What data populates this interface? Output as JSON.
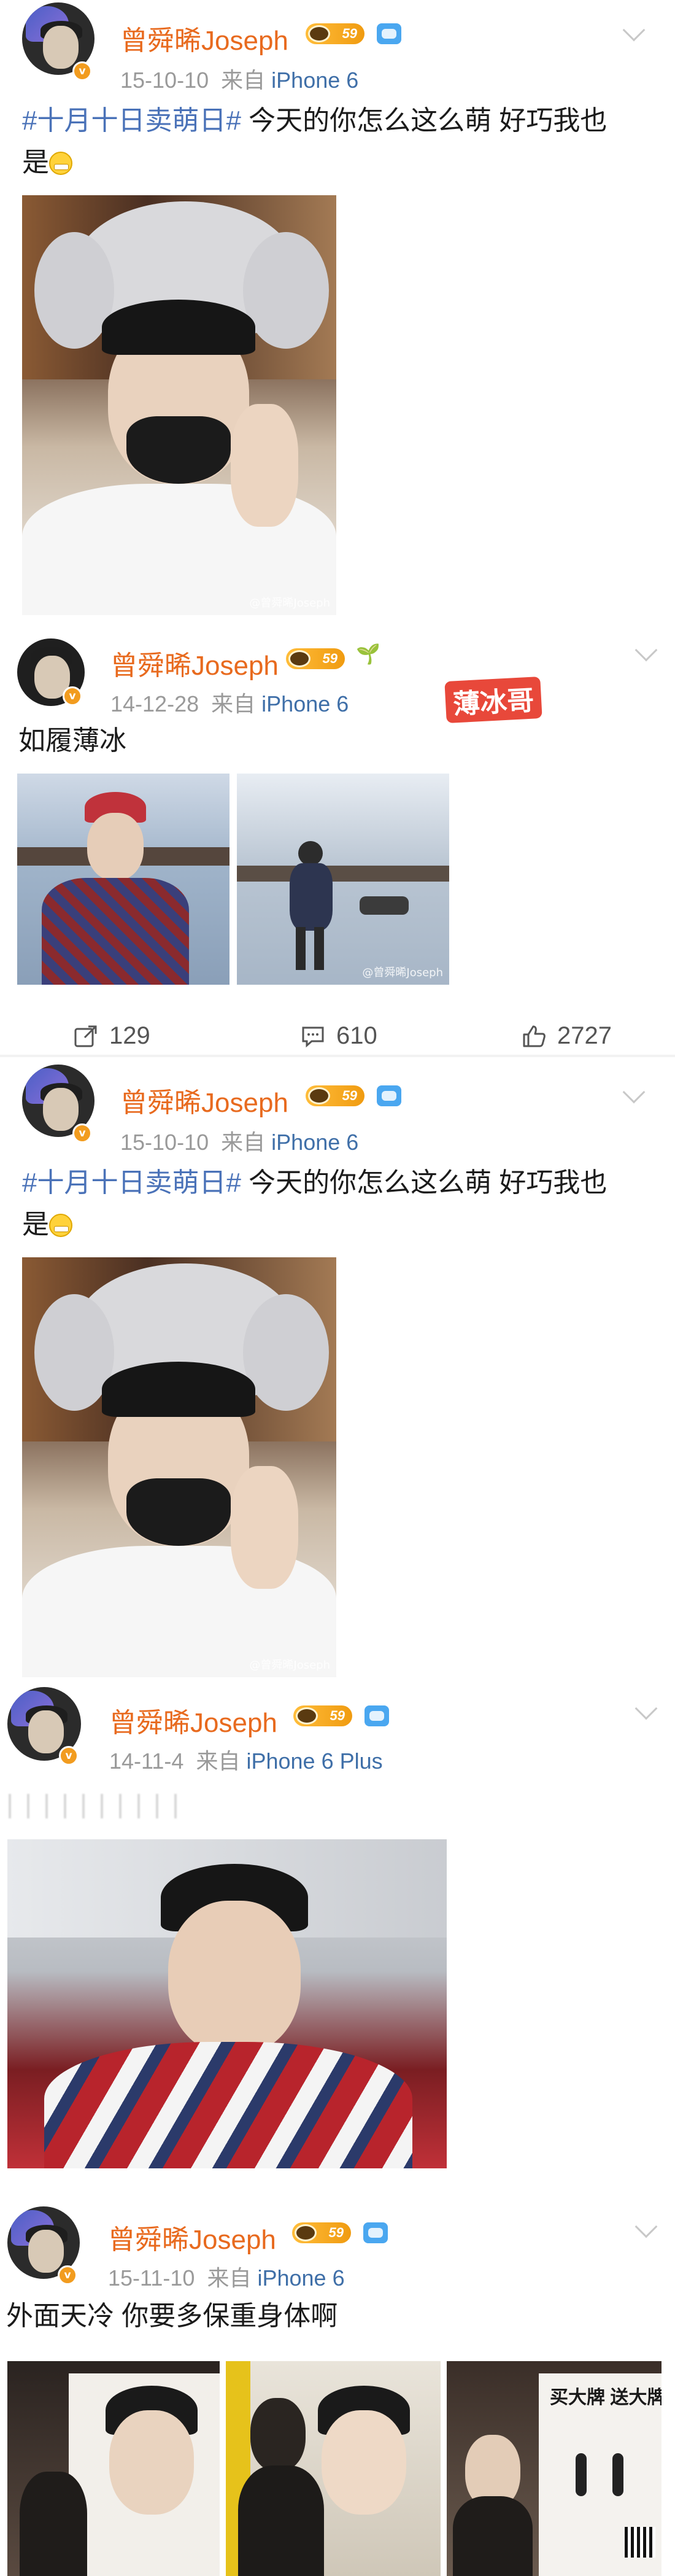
{
  "user": {
    "name": "曾舜晞Joseph",
    "level": "59",
    "verified_mark": "v"
  },
  "posts": [
    {
      "date": "15-10-10",
      "source_prefix": "来自",
      "source": "iPhone 6",
      "hashtag": "#十月十日卖萌日#",
      "text_line1": " 今天的你怎么这么萌 好巧我也",
      "text_line2": "是",
      "photo_watermark": "@曾舜晞Joseph"
    },
    {
      "date": "14-12-28",
      "source_prefix": "来自",
      "source": "iPhone 6",
      "text": "如履薄冰",
      "stamp": "薄冰哥",
      "photo_watermark": "@曾舜晞Joseph",
      "actions": {
        "repost_count": "129",
        "comment_count": "610",
        "like_count": "2727"
      }
    },
    {
      "date": "15-10-10",
      "source_prefix": "来自",
      "source": "iPhone 6",
      "hashtag": "#十月十日卖萌日#",
      "text_line1": " 今天的你怎么这么萌 好巧我也",
      "text_line2": "是",
      "photo_watermark": "@曾舜晞Joseph"
    },
    {
      "date": "14-11-4",
      "source_prefix": "来自",
      "source": "iPhone 6 Plus"
    },
    {
      "date": "15-11-10",
      "source_prefix": "来自",
      "source": "iPhone 6",
      "text": "外面天冷 你要多保重身体啊",
      "ad_text": "买大牌 送大牌"
    }
  ],
  "icons": {
    "more": "chevron-down-icon",
    "repost": "repost-icon",
    "comment": "comment-icon",
    "like": "like-icon",
    "emoji": "grin-emoji-icon",
    "level": "level-badge-icon",
    "vip": "vip-icon",
    "sprout": "sprout-icon"
  },
  "colors": {
    "username": "#e86a1e",
    "hashtag": "#4a72b8",
    "source": "#3f6fa8",
    "meta": "#9a9a9a",
    "stamp": "#e8483a"
  }
}
